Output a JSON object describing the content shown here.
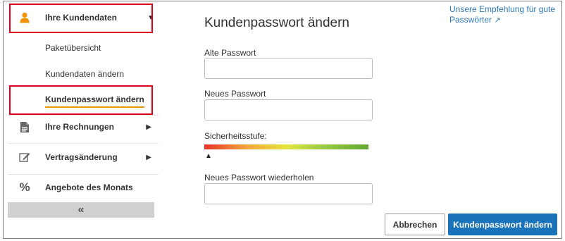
{
  "sidebar": {
    "customer_data": {
      "label": "Ihre Kundendaten"
    },
    "sub_items": [
      {
        "label": "Paketübersicht"
      },
      {
        "label": "Kundendaten ändern"
      },
      {
        "label": "Kundenpasswort ändern"
      }
    ],
    "invoices": {
      "label": "Ihre Rechnungen"
    },
    "contract_change": {
      "label": "Vertragsänderung"
    },
    "offers": {
      "label": "Angebote des Monats"
    },
    "collapse_label": "«"
  },
  "main": {
    "title": "Kundenpasswort ändern",
    "old_password_label": "Alte Passwort",
    "new_password_label": "Neues Passwort",
    "strength_label": "Sicherheitsstufe:",
    "strength_marker": "▲",
    "repeat_password_label": "Neues Passwort wiederholen",
    "recommendation_line1": "Unsere Empfehlung für gute",
    "recommendation_line2": "Passwörter",
    "external_link_icon": "↗",
    "cancel_label": "Abbrechen",
    "submit_label": "Kundenpasswort ändern"
  },
  "colors": {
    "highlight": "#e0001a",
    "accent_orange": "#f39200",
    "primary_button": "#1a73b8",
    "link": "#2f78b5"
  }
}
